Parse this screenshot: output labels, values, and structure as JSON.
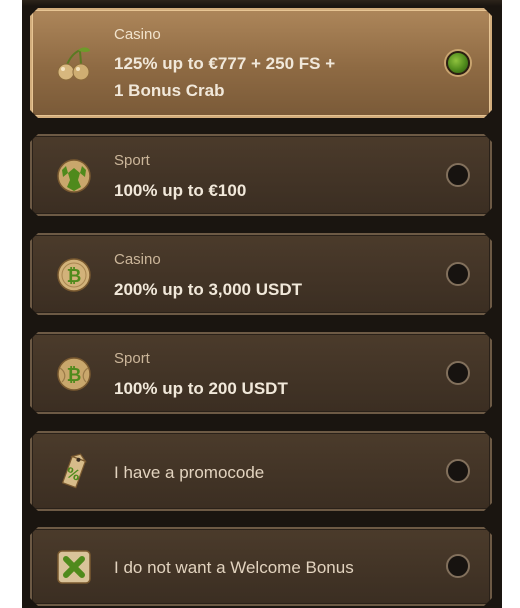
{
  "options": [
    {
      "category": "Casino",
      "line1": "125% up to €777 + 250 FS +",
      "line2": "1 Bonus Crab",
      "icon": "cherries-icon",
      "selected": true
    },
    {
      "category": "Sport",
      "line1": "100% up to €100",
      "icon": "soccer-ball-icon",
      "selected": false
    },
    {
      "category": "Casino",
      "line1": "200% up to 3,000 USDT",
      "icon": "bitcoin-coin-icon",
      "selected": false
    },
    {
      "category": "Sport",
      "line1": "100% up to 200 USDT",
      "icon": "bitcoin-ball-icon",
      "selected": false
    },
    {
      "line1": "I have a promocode",
      "icon": "promo-tag-icon",
      "selected": false
    },
    {
      "line1": "I do not want a Welcome Bonus",
      "icon": "no-bonus-icon",
      "selected": false
    }
  ],
  "colors": {
    "accent_green": "#6aa12a",
    "selected_bg": "#9a7549",
    "card_bg": "#433426"
  }
}
